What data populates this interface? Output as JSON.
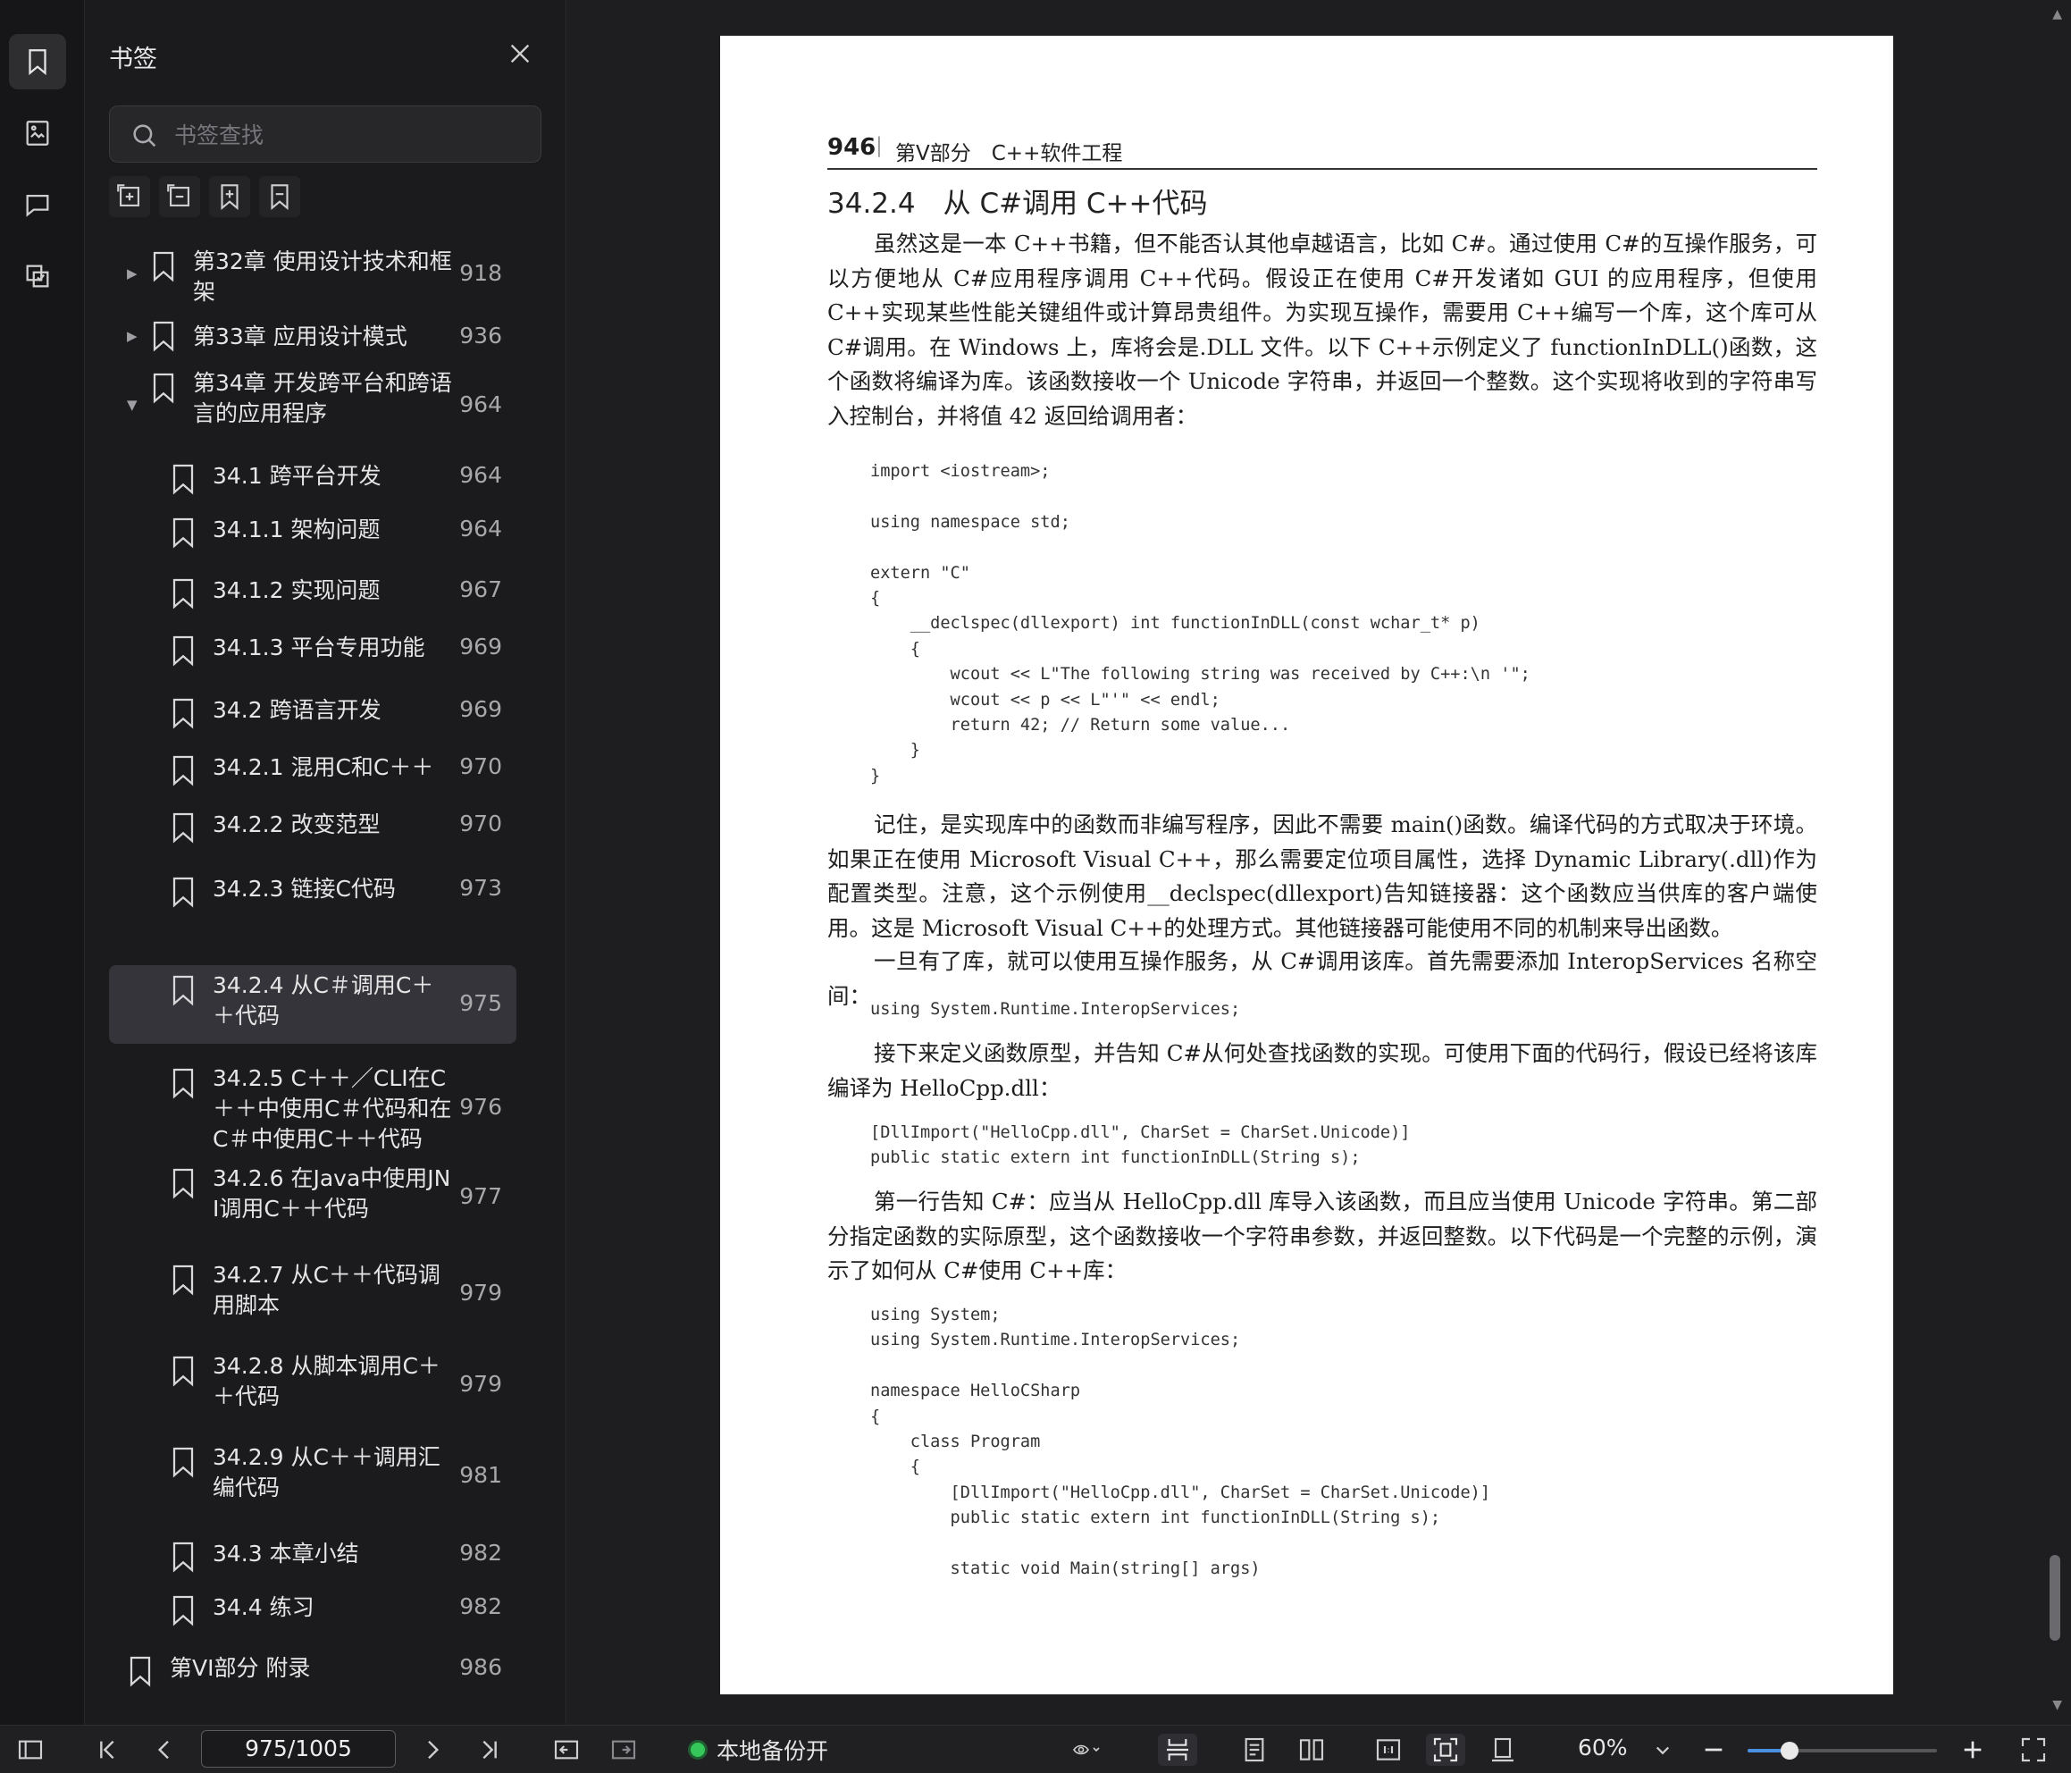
{
  "panel": {
    "title": "书签",
    "search_placeholder": "书签查找"
  },
  "bookmarks": [
    {
      "label": "第32章  使用设计技术和框架",
      "page": "918",
      "level": 0,
      "arrow": "▶"
    },
    {
      "label": "第33章  应用设计模式",
      "page": "936",
      "level": 0,
      "arrow": "▶"
    },
    {
      "label": "第34章  开发跨平台和跨语言的应用程序",
      "page": "964",
      "level": 0,
      "arrow": "▼"
    },
    {
      "label": "34.1  跨平台开发",
      "page": "964",
      "level": 1
    },
    {
      "label": "34.1.1  架构问题",
      "page": "964",
      "level": 1
    },
    {
      "label": "34.1.2  实现问题",
      "page": "967",
      "level": 1
    },
    {
      "label": "34.1.3  平台专用功能",
      "page": "969",
      "level": 1
    },
    {
      "label": "34.2  跨语言开发",
      "page": "969",
      "level": 1
    },
    {
      "label": "34.2.1  混用C和C＋＋",
      "page": "970",
      "level": 1
    },
    {
      "label": "34.2.2  改变范型",
      "page": "970",
      "level": 1
    },
    {
      "label": "34.2.3  链接C代码",
      "page": "973",
      "level": 1
    },
    {
      "label": "34.2.4  从C＃调用C＋＋代码",
      "page": "975",
      "level": 1,
      "selected": true
    },
    {
      "label": "34.2.5  C＋＋／CLI在C＋＋中使用C＃代码和在C＃中使用C＋＋代码",
      "page": "976",
      "level": 1
    },
    {
      "label": "34.2.6  在Java中使用JNI调用C＋＋代码",
      "page": "977",
      "level": 1
    },
    {
      "label": "34.2.7  从C＋＋代码调用脚本",
      "page": "979",
      "level": 1
    },
    {
      "label": "34.2.8  从脚本调用C＋＋代码",
      "page": "979",
      "level": 1
    },
    {
      "label": "34.2.9  从C＋＋调用汇编代码",
      "page": "981",
      "level": 1
    },
    {
      "label": "34.3  本章小结",
      "page": "982",
      "level": 1
    },
    {
      "label": "34.4  练习",
      "page": "982",
      "level": 1
    },
    {
      "label": "第VI部分  附录",
      "page": "986",
      "level": -1
    }
  ],
  "document": {
    "page_number": "946",
    "part_title": "第Ⅴ部分　C++软件工程",
    "section_title": "34.2.4　从 C#调用 C++代码",
    "para1": "虽然这是一本 C++书籍，但不能否认其他卓越语言，比如 C#。通过使用 C#的互操作服务，可以方便地从 C#应用程序调用 C++代码。假设正在使用 C#开发诸如 GUI 的应用程序，但使用 C++实现某些性能关键组件或计算昂贵组件。为实现互操作，需要用 C++编写一个库，这个库可从 C#调用。在 Windows 上，库将会是.DLL 文件。以下 C++示例定义了 functionInDLL()函数，这个函数将编译为库。该函数接收一个 Unicode 字符串，并返回一个整数。这个实现将收到的字符串写入控制台，并将值 42 返回给调用者：",
    "code1": "import <iostream>;\n\nusing namespace std;\n\nextern \"C\"\n{\n    __declspec(dllexport) int functionInDLL(const wchar_t* p)\n    {\n        wcout << L\"The following string was received by C++:\\n '\";\n        wcout << p << L\"'\" << endl;\n        return 42; // Return some value...\n    }\n}",
    "para2": "记住，是实现库中的函数而非编写程序，因此不需要 main()函数。编译代码的方式取决于环境。如果正在使用 Microsoft Visual C++，那么需要定位项目属性，选择 Dynamic Library(.dll)作为配置类型。注意，这个示例使用__declspec(dllexport)告知链接器：这个函数应当供库的客户端使用。这是 Microsoft Visual C++的处理方式。其他链接器可能使用不同的机制来导出函数。",
    "para3": "一旦有了库，就可以使用互操作服务，从 C#调用该库。首先需要添加 InteropServices 名称空间：",
    "code2": "using System.Runtime.InteropServices;",
    "para4": "接下来定义函数原型，并告知 C#从何处查找函数的实现。可使用下面的代码行，假设已经将该库编译为 HelloCpp.dll：",
    "code3": "[DllImport(\"HelloCpp.dll\", CharSet = CharSet.Unicode)]\npublic static extern int functionInDLL(String s);",
    "para5": "第一行告知 C#：应当从 HelloCpp.dll 库导入该函数，而且应当使用 Unicode 字符串。第二部分指定函数的实际原型，这个函数接收一个字符串参数，并返回整数。以下代码是一个完整的示例，演示了如何从 C#使用 C++库：",
    "code4": "using System;\nusing System.Runtime.InteropServices;\n\nnamespace HelloCSharp\n{\n    class Program\n    {\n        [DllImport(\"HelloCpp.dll\", CharSet = CharSet.Unicode)]\n        public static extern int functionInDLL(String s);\n\n        static void Main(string[] args)"
  },
  "bottombar": {
    "page_indicator": "975/1005",
    "backup_label": "本地备份开",
    "zoom": "60%",
    "zoom_level": 0.22
  }
}
